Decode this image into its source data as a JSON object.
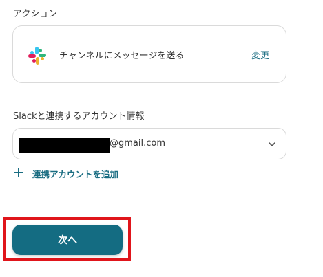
{
  "action_section": {
    "label": "アクション",
    "action_text": "チャンネルにメッセージを送る",
    "change_label": "変更",
    "app_icon": "slack-icon"
  },
  "account_section": {
    "label": "Slackと連携するアカウント情報",
    "selected_value": "@gmail.com",
    "selected_value_redacted": true,
    "add_account_label": "連携アカウントを追加"
  },
  "footer": {
    "next_label": "次へ",
    "highlight": true
  },
  "colors": {
    "accent": "#1a6d82",
    "button_bg": "#146c82",
    "highlight_border": "#e0151b",
    "slack_blue": "#36c5f0",
    "slack_green": "#2eb67d",
    "slack_yellow": "#ecb22e",
    "slack_red": "#e01e5a"
  }
}
